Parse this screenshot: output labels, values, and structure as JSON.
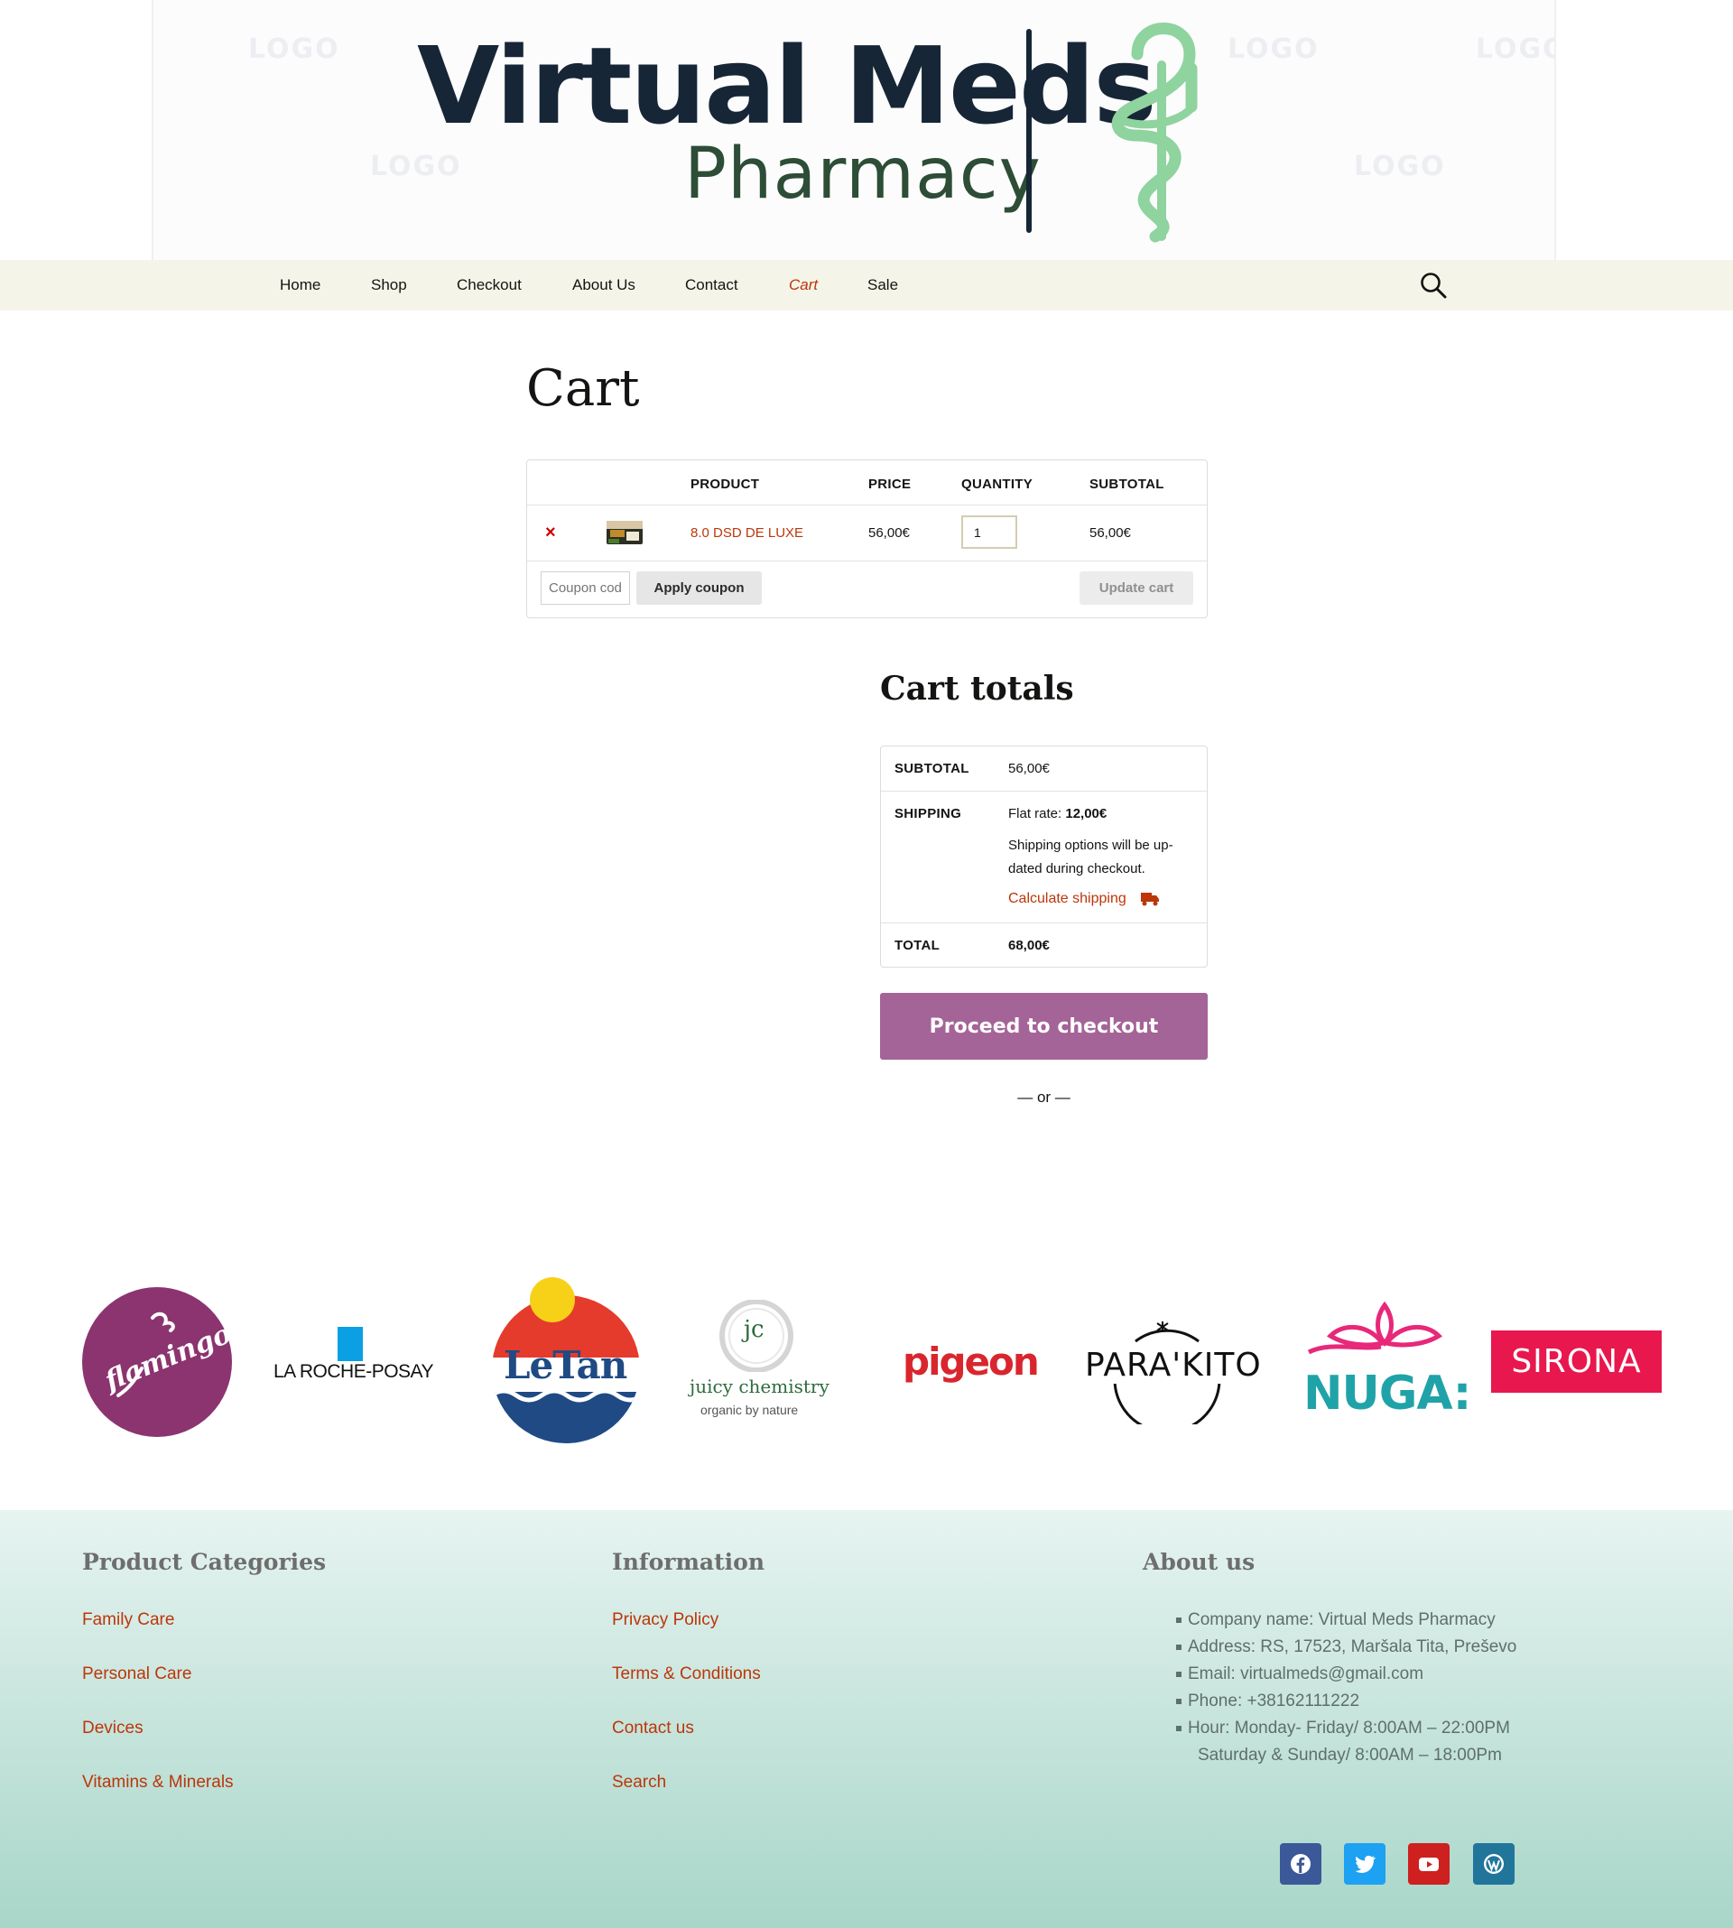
{
  "header": {
    "logo": {
      "title": "Virtual Meds",
      "subtitle": "Pharmacy",
      "watermark": "LOGO"
    }
  },
  "nav": {
    "items": [
      "Home",
      "Shop",
      "Checkout",
      "About Us",
      "Contact",
      "Cart",
      "Sale"
    ],
    "active": "Cart",
    "search_icon": "search-icon"
  },
  "cart": {
    "title": "Cart",
    "columns": {
      "product": "PRODUCT",
      "price": "PRICE",
      "quantity": "QUANTITY",
      "subtotal": "SUBTOTAL"
    },
    "items": [
      {
        "remove": "×",
        "name": "8.0 DSD DE LUXE",
        "price": "56,00€",
        "quantity": "1",
        "subtotal": "56,00€"
      }
    ],
    "coupon_placeholder": "Coupon code",
    "apply_coupon": "Apply coupon",
    "update_cart": "Update cart"
  },
  "totals": {
    "title": "Cart totals",
    "subtotal_label": "SUBTOTAL",
    "subtotal_value": "56,00€",
    "shipping_label": "SHIPPING",
    "flat_rate_label": "Flat rate:",
    "flat_rate_value": "12,00€",
    "shipping_note_line1": "Shipping options will be up-",
    "shipping_note_line2": "dated during checkout.",
    "calculate_shipping": "Calculate shipping",
    "total_label": "TOTAL",
    "total_value": "68,00€",
    "checkout_button": "Proceed to checkout",
    "or": "— or —"
  },
  "brands": {
    "flamingo": "flamingo",
    "laroche": "LA ROCHE-POSAY",
    "letan": "LeTan",
    "juicy_jc": "jc",
    "juicy_name": "juicy chemistry",
    "juicy_tag": "organic by nature",
    "pigeon": "pigeon",
    "parakito": "PARA'KITO",
    "nuga": "NUGA:",
    "sirona": "SIRONA"
  },
  "footer": {
    "categories_title": "Product Categories",
    "categories": [
      "Family Care",
      "Personal Care",
      "Devices",
      "Vitamins & Minerals"
    ],
    "information_title": "Information",
    "information": [
      "Privacy Policy",
      "Terms & Conditions",
      "Contact us",
      "Search"
    ],
    "about_title": "About us",
    "about": [
      "Company name: Virtual Meds Pharmacy",
      "Address: RS, 17523, Maršala Tita, Preševo",
      "Email: virtualmeds@gmail.com",
      "Phone: +38162111222",
      "Hour: Monday- Friday/ 8:00AM – 22:00PM"
    ],
    "about_hours_weekend": "Saturday & Sunday/ 8:00AM – 18:00Pm",
    "social": [
      "facebook-icon",
      "twitter-icon",
      "youtube-icon",
      "wordpress-icon"
    ]
  },
  "colors": {
    "accent": "#bc360a",
    "nav_bg": "#f5f4e8",
    "checkout": "#a46497",
    "logo_dark": "#162636",
    "logo_green": "#8fd39e"
  }
}
